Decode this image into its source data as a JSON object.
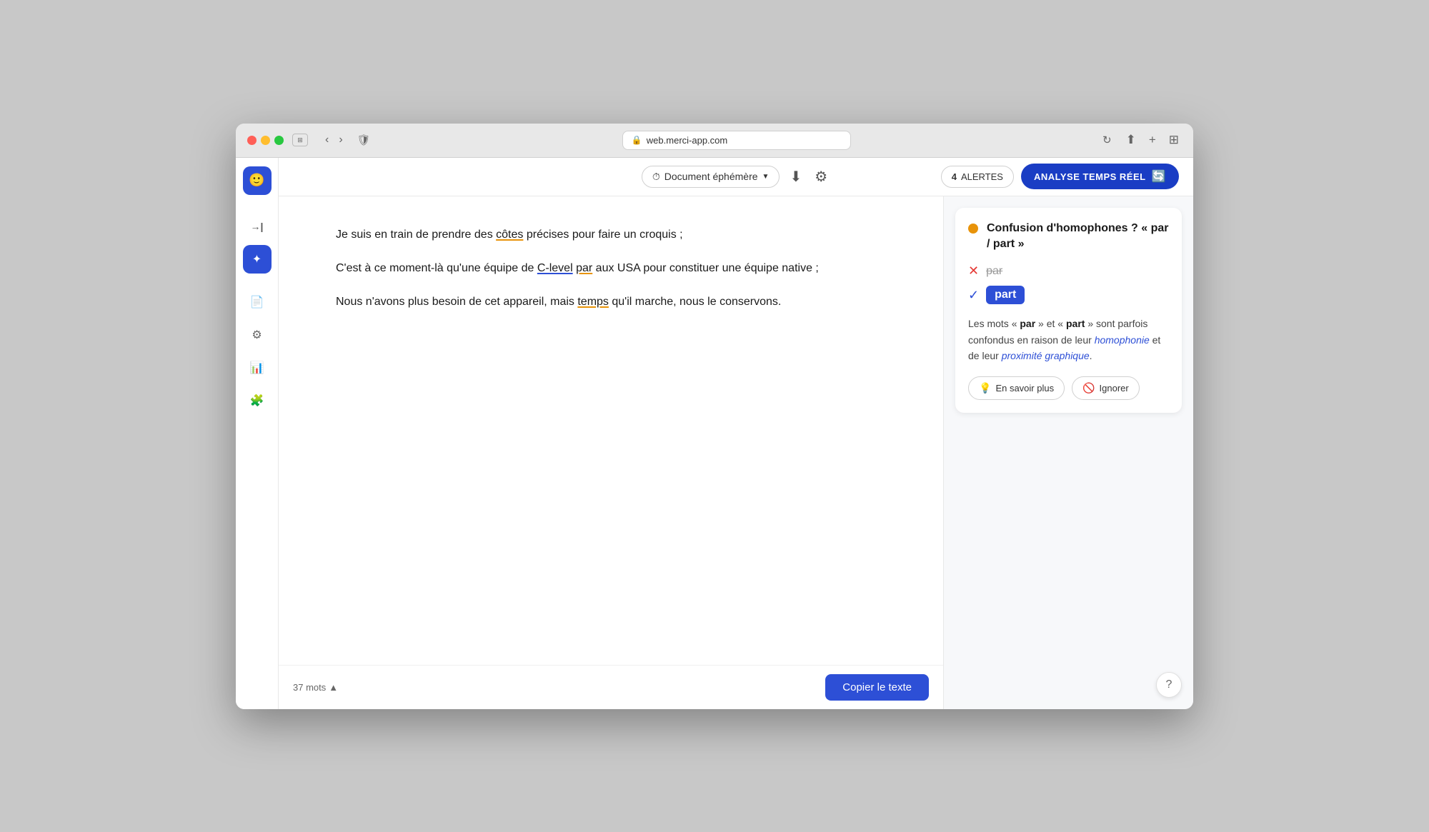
{
  "browser": {
    "url": "web.merci-app.com",
    "url_icon": "🔒"
  },
  "toolbar": {
    "doc_type_label": "Document éphémère",
    "doc_type_icon": "⏱",
    "alerts_count": "4",
    "alerts_label": "ALERTES",
    "analyse_label": "ANALYSE TEMPS RÉEL",
    "analyse_emoji": "🔄"
  },
  "editor": {
    "paragraphs": [
      {
        "id": "p1",
        "text_parts": [
          {
            "text": "Je suis en train de prendre des ",
            "type": "normal"
          },
          {
            "text": "côtes",
            "type": "underline-orange"
          },
          {
            "text": " précises pour faire un croquis ;",
            "type": "normal"
          }
        ]
      },
      {
        "id": "p2",
        "text_parts": [
          {
            "text": "C'est à ce moment-là qu'une équipe de ",
            "type": "normal"
          },
          {
            "text": "C-level",
            "type": "underline-blue"
          },
          {
            "text": " ",
            "type": "normal"
          },
          {
            "text": "par",
            "type": "underline-orange"
          },
          {
            "text": " aux USA pour constituer une équipe native ;",
            "type": "normal"
          }
        ]
      },
      {
        "id": "p3",
        "text_parts": [
          {
            "text": "Nous n'avons plus besoin de cet appareil, mais ",
            "type": "normal"
          },
          {
            "text": "temps",
            "type": "underline-orange"
          },
          {
            "text": " qu'il marche, nous le conservons.",
            "type": "normal"
          }
        ]
      }
    ],
    "word_count": "37 mots",
    "copy_button": "Copier le texte"
  },
  "suggestion": {
    "dot_color": "#e8930a",
    "title": "Confusion d'homophones ? « par / part »",
    "wrong_word": "par",
    "correct_word": "part",
    "description_before": "Les mots « ",
    "desc_bold1": "par",
    "description_mid1": " » et « ",
    "desc_bold2": "part",
    "description_mid2": " » sont parfois confondus en raison de leur ",
    "desc_italic1": "homophonie",
    "description_mid3": " et de leur ",
    "desc_italic2": "proximité graphique",
    "description_end": ".",
    "btn_learn_more": "En savoir plus",
    "btn_ignore": "Ignorer"
  },
  "sidebar": {
    "items": [
      {
        "id": "logo",
        "icon": "🙂",
        "active": true,
        "is_logo": true
      },
      {
        "id": "arrow",
        "icon": "→|",
        "active": false
      },
      {
        "id": "edit",
        "icon": "✏",
        "active": true
      },
      {
        "id": "doc",
        "icon": "📄",
        "active": false
      },
      {
        "id": "settings",
        "icon": "⚙",
        "active": false
      },
      {
        "id": "chart",
        "icon": "📊",
        "active": false
      },
      {
        "id": "puzzle",
        "icon": "🧩",
        "active": false
      }
    ]
  },
  "help": {
    "label": "?"
  }
}
